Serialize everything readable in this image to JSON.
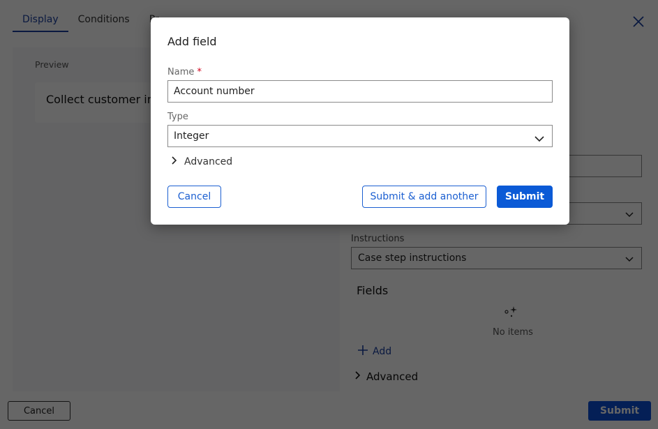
{
  "tabs": [
    {
      "label": "Display",
      "active": true
    },
    {
      "label": "Conditions",
      "active": false
    },
    {
      "label": "Pr",
      "active": false
    }
  ],
  "icons": {
    "close": "close-icon",
    "chevron_down": "chevron-down-icon",
    "chevron_right": "chevron-right-icon",
    "plus": "plus-icon",
    "sparkle": "sparkle-empty-icon"
  },
  "preview": {
    "label": "Preview",
    "card_title": "Collect customer information"
  },
  "right_panel": {
    "instructions_label": "Instructions",
    "instructions_value": "Case step instructions",
    "fields_title": "Fields",
    "empty_text": "No items",
    "add_label": "Add",
    "advanced_label": "Advanced"
  },
  "footer": {
    "cancel_label": "Cancel",
    "submit_label": "Submit"
  },
  "modal": {
    "title": "Add field",
    "name_label": "Name",
    "required_marker": "*",
    "name_value": "Account number",
    "type_label": "Type",
    "type_value": "Integer",
    "advanced_label": "Advanced",
    "cancel_label": "Cancel",
    "submit_another_label": "Submit & add another",
    "submit_label": "Submit"
  },
  "colors": {
    "accent": "#1b5fd1",
    "primary_button": "#0b5ad6",
    "required": "#d0021b",
    "tab_active": "#1b3fa0"
  }
}
